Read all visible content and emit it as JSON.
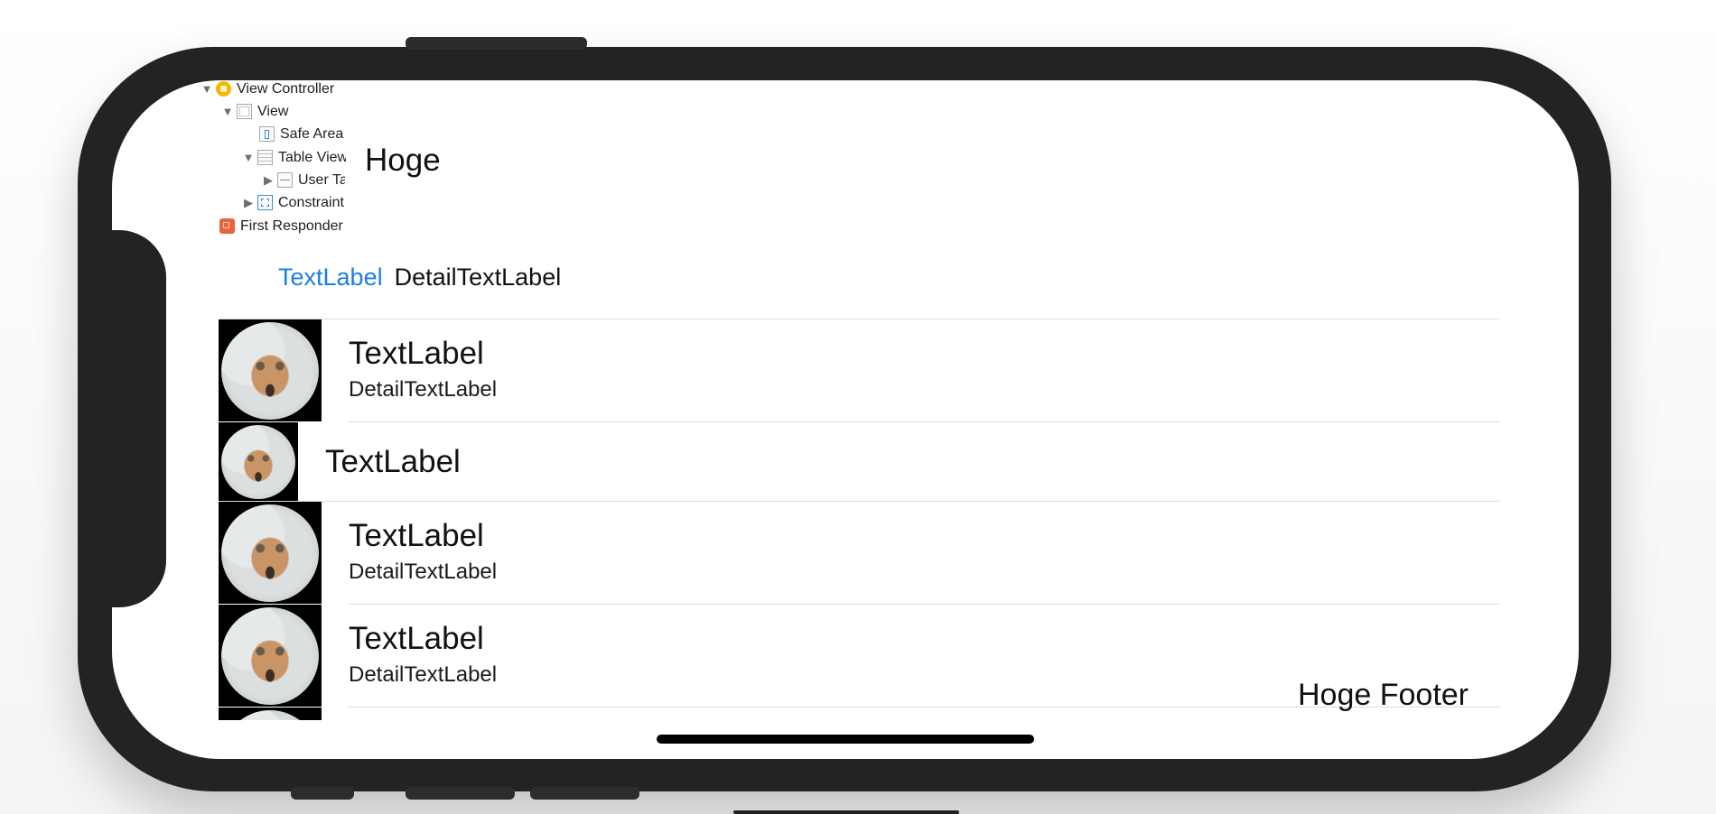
{
  "tree": [
    {
      "label": "View Controller",
      "icon": "view-controller-icon",
      "expanded": true
    },
    {
      "label": "View",
      "icon": "view-icon",
      "expanded": true
    },
    {
      "label": "Safe Area",
      "icon": "safe-area-icon"
    },
    {
      "label": "Table View",
      "icon": "table-view-icon",
      "expanded": true
    },
    {
      "label": "User Ta",
      "icon": "table-cell-icon",
      "expanded": false
    },
    {
      "label": "Constraint",
      "icon": "constraints-icon",
      "expanded": false
    },
    {
      "label": "First Responder",
      "icon": "first-responder-icon"
    }
  ],
  "header": {
    "title": "Hoge",
    "text_label": "TextLabel",
    "detail_text_label": "DetailTextLabel",
    "text_label_color": "#1a7fe4"
  },
  "cells": [
    {
      "title": "TextLabel",
      "detail": "DetailTextLabel"
    },
    {
      "title": "TextLabel"
    },
    {
      "title": "TextLabel",
      "detail": "DetailTextLabel"
    },
    {
      "title": "TextLabel",
      "detail": "DetailTextLabel"
    }
  ],
  "footer": {
    "title": "Hoge Footer"
  }
}
